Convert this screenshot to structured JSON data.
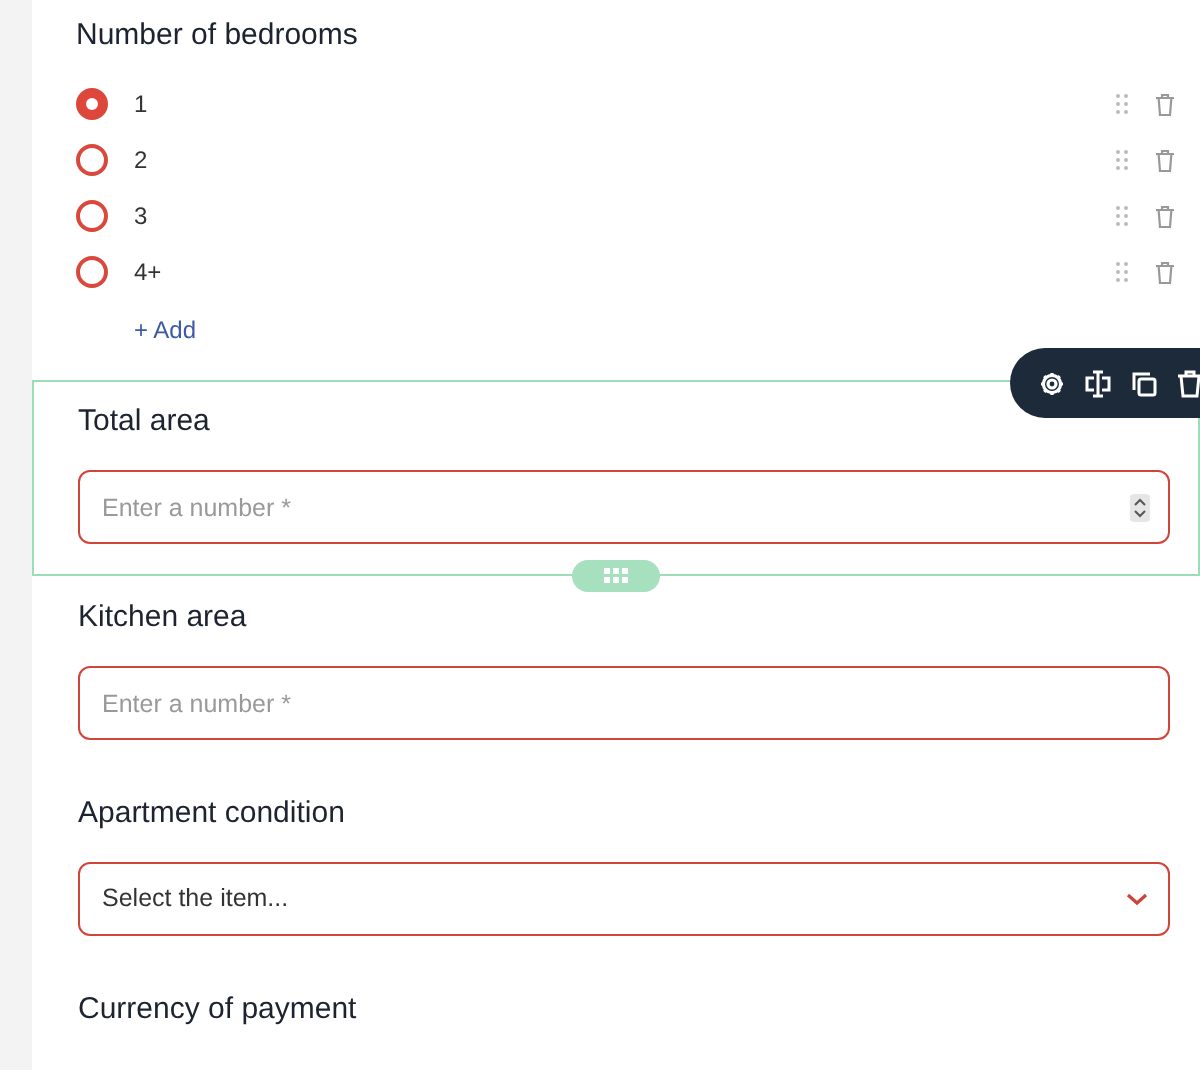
{
  "bedrooms": {
    "label": "Number of bedrooms",
    "options": [
      {
        "label": "1",
        "selected": true
      },
      {
        "label": "2",
        "selected": false
      },
      {
        "label": "3",
        "selected": false
      },
      {
        "label": "4+",
        "selected": false
      }
    ],
    "add_link": "+ Add"
  },
  "fields": [
    {
      "kind": "number",
      "label": "Total area",
      "placeholder": "Enter a number *",
      "active": true
    },
    {
      "kind": "number",
      "label": "Kitchen area",
      "placeholder": "Enter a number *",
      "active": false
    },
    {
      "kind": "select",
      "label": "Apartment condition",
      "value": "Select the item...",
      "active": false
    },
    {
      "kind": "heading",
      "label": "Currency of payment"
    }
  ]
}
